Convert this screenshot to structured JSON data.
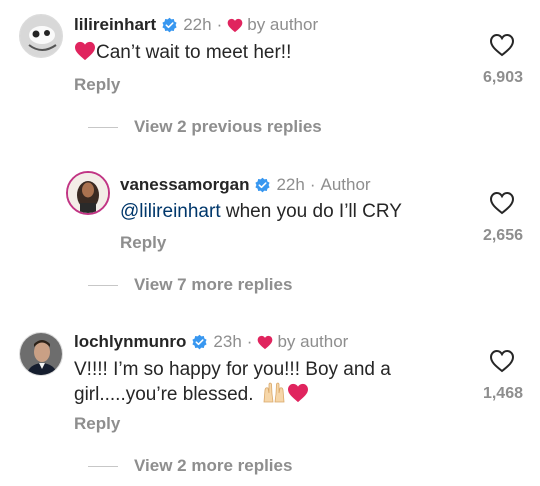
{
  "colors": {
    "verified": "#3897f0",
    "heart": "#e0245e",
    "muted": "#8e8e8e",
    "mention": "#00376b"
  },
  "reply_label": "Reply",
  "comments": [
    {
      "username": "lilireinhart",
      "time": "22h",
      "by_author": "by author",
      "text": "Can’t wait to meet her!!",
      "likes": "6,903",
      "view_replies": "View 2 previous replies"
    },
    {
      "username": "vanessamorgan",
      "time": "22h",
      "author_label": "Author",
      "mention": "@lilireinhart",
      "text": " when you do I’ll CRY",
      "likes": "2,656",
      "view_replies": "View 7 more replies"
    },
    {
      "username": "lochlynmunro",
      "time": "23h",
      "by_author": "by author",
      "text_line1": "V!!!! I’m so happy for you!!! Boy and a",
      "text_line2": "girl.....you’re blessed.",
      "likes": "1,468",
      "view_replies": "View 2 more replies"
    }
  ]
}
